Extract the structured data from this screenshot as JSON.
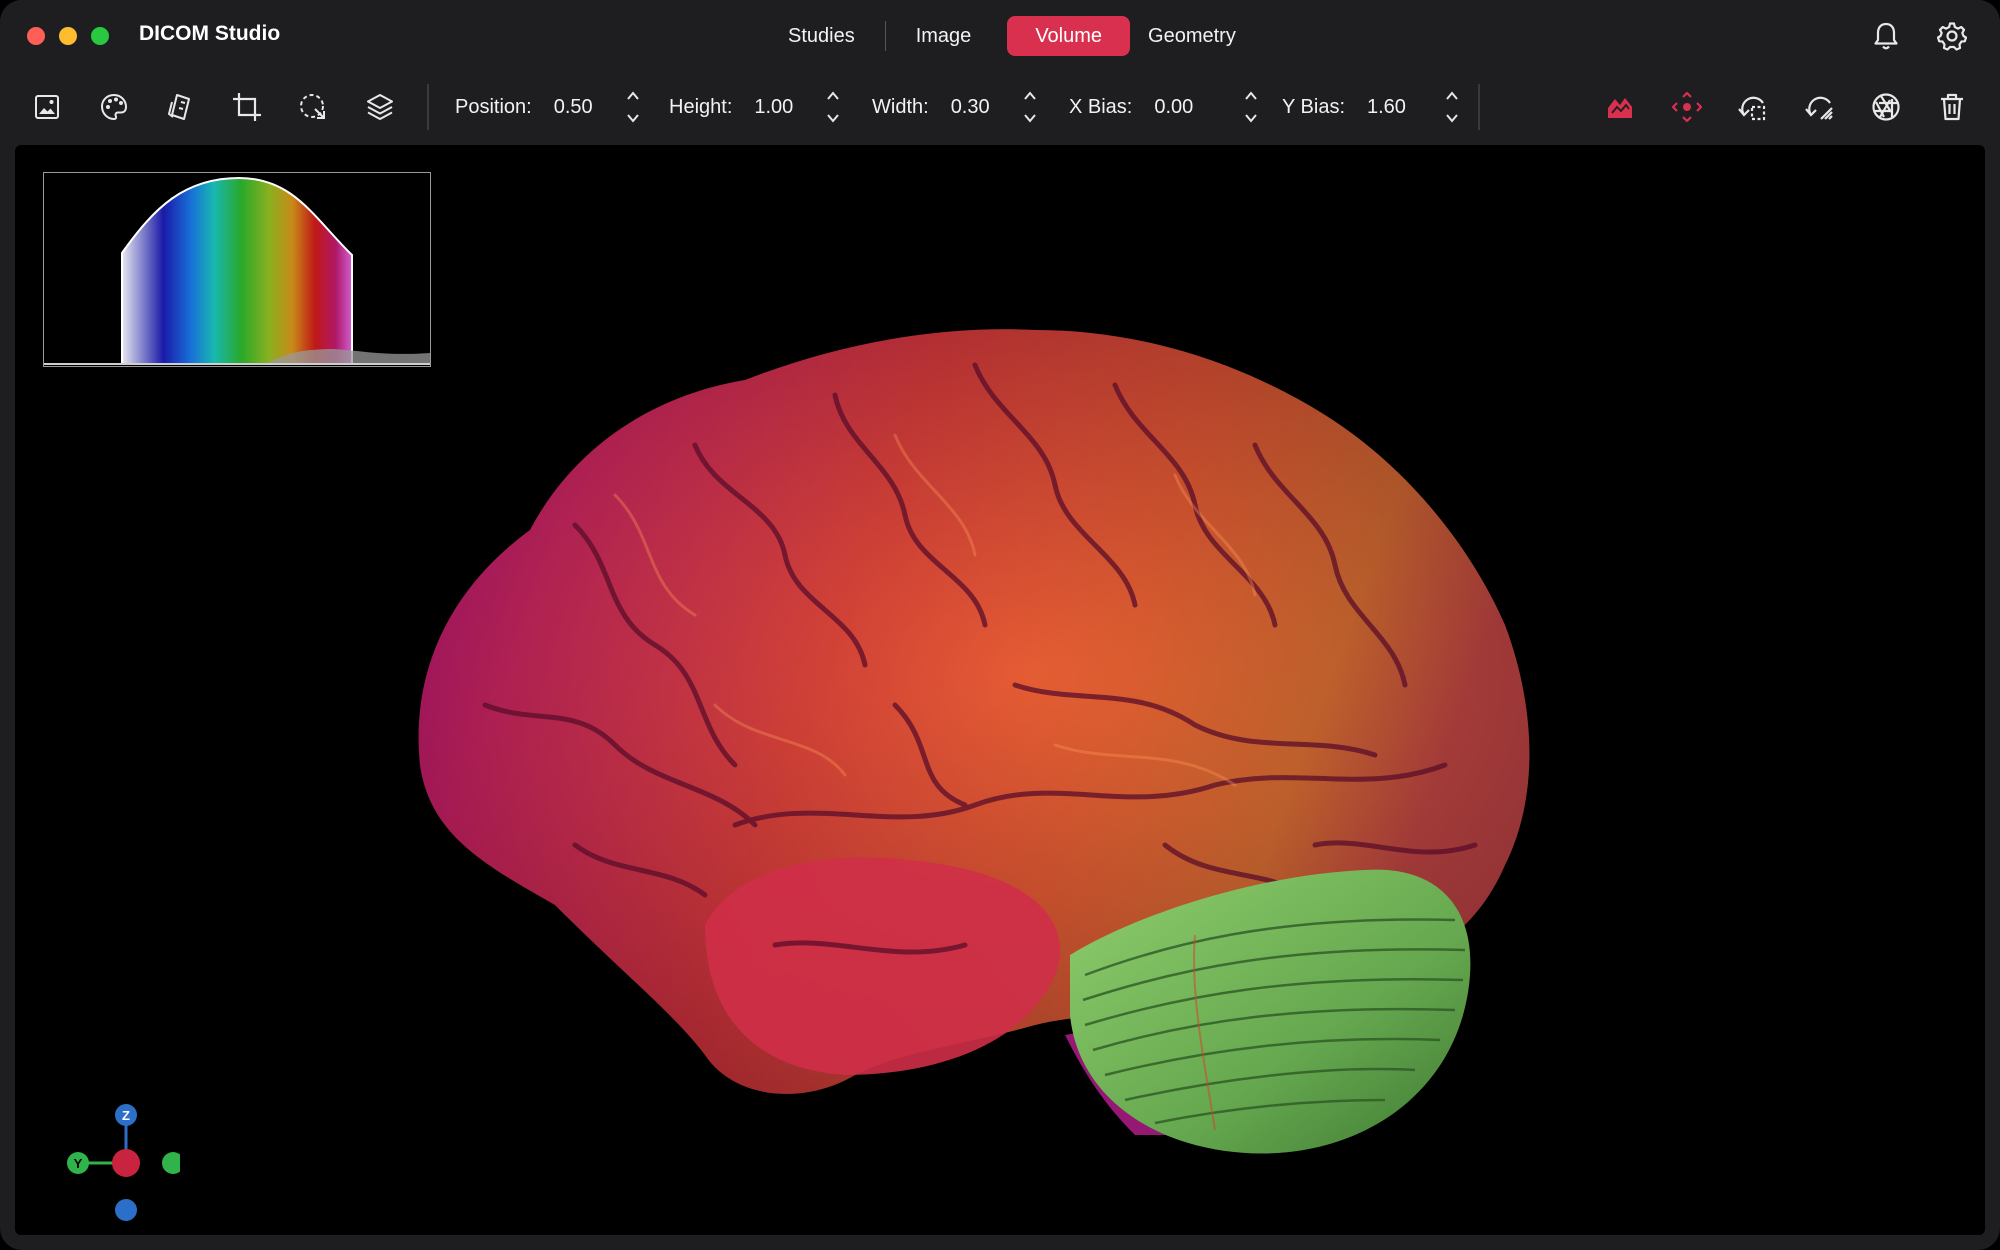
{
  "app": {
    "title": "DICOM Studio"
  },
  "tabs": [
    {
      "label": "Studies",
      "active": false
    },
    {
      "label": "Image",
      "active": false
    },
    {
      "label": "Volume",
      "active": true
    },
    {
      "label": "Geometry",
      "active": false
    }
  ],
  "titlebar_icons": [
    "bell-icon",
    "gear-icon"
  ],
  "toolbar": {
    "left_tools": [
      "image-icon",
      "palette-icon",
      "window-level-icon",
      "crop-icon",
      "lasso-select-icon",
      "layers-icon"
    ],
    "params": [
      {
        "label": "Position:",
        "value": "0.50"
      },
      {
        "label": "Height:",
        "value": "1.00"
      },
      {
        "label": "Width:",
        "value": "0.30"
      },
      {
        "label": "X Bias:",
        "value": "0.00"
      },
      {
        "label": "Y Bias:",
        "value": "1.60"
      }
    ],
    "right_tools": [
      "transfer-function-icon",
      "move-icon",
      "rotate-select-icon",
      "rotate-icon",
      "aperture-icon",
      "trash-icon"
    ]
  },
  "axis_gizmo": {
    "z": "Z",
    "y": "Y"
  },
  "colors": {
    "accent": "#d9304f",
    "background": "#1e1e20",
    "viewport": "#000000"
  }
}
